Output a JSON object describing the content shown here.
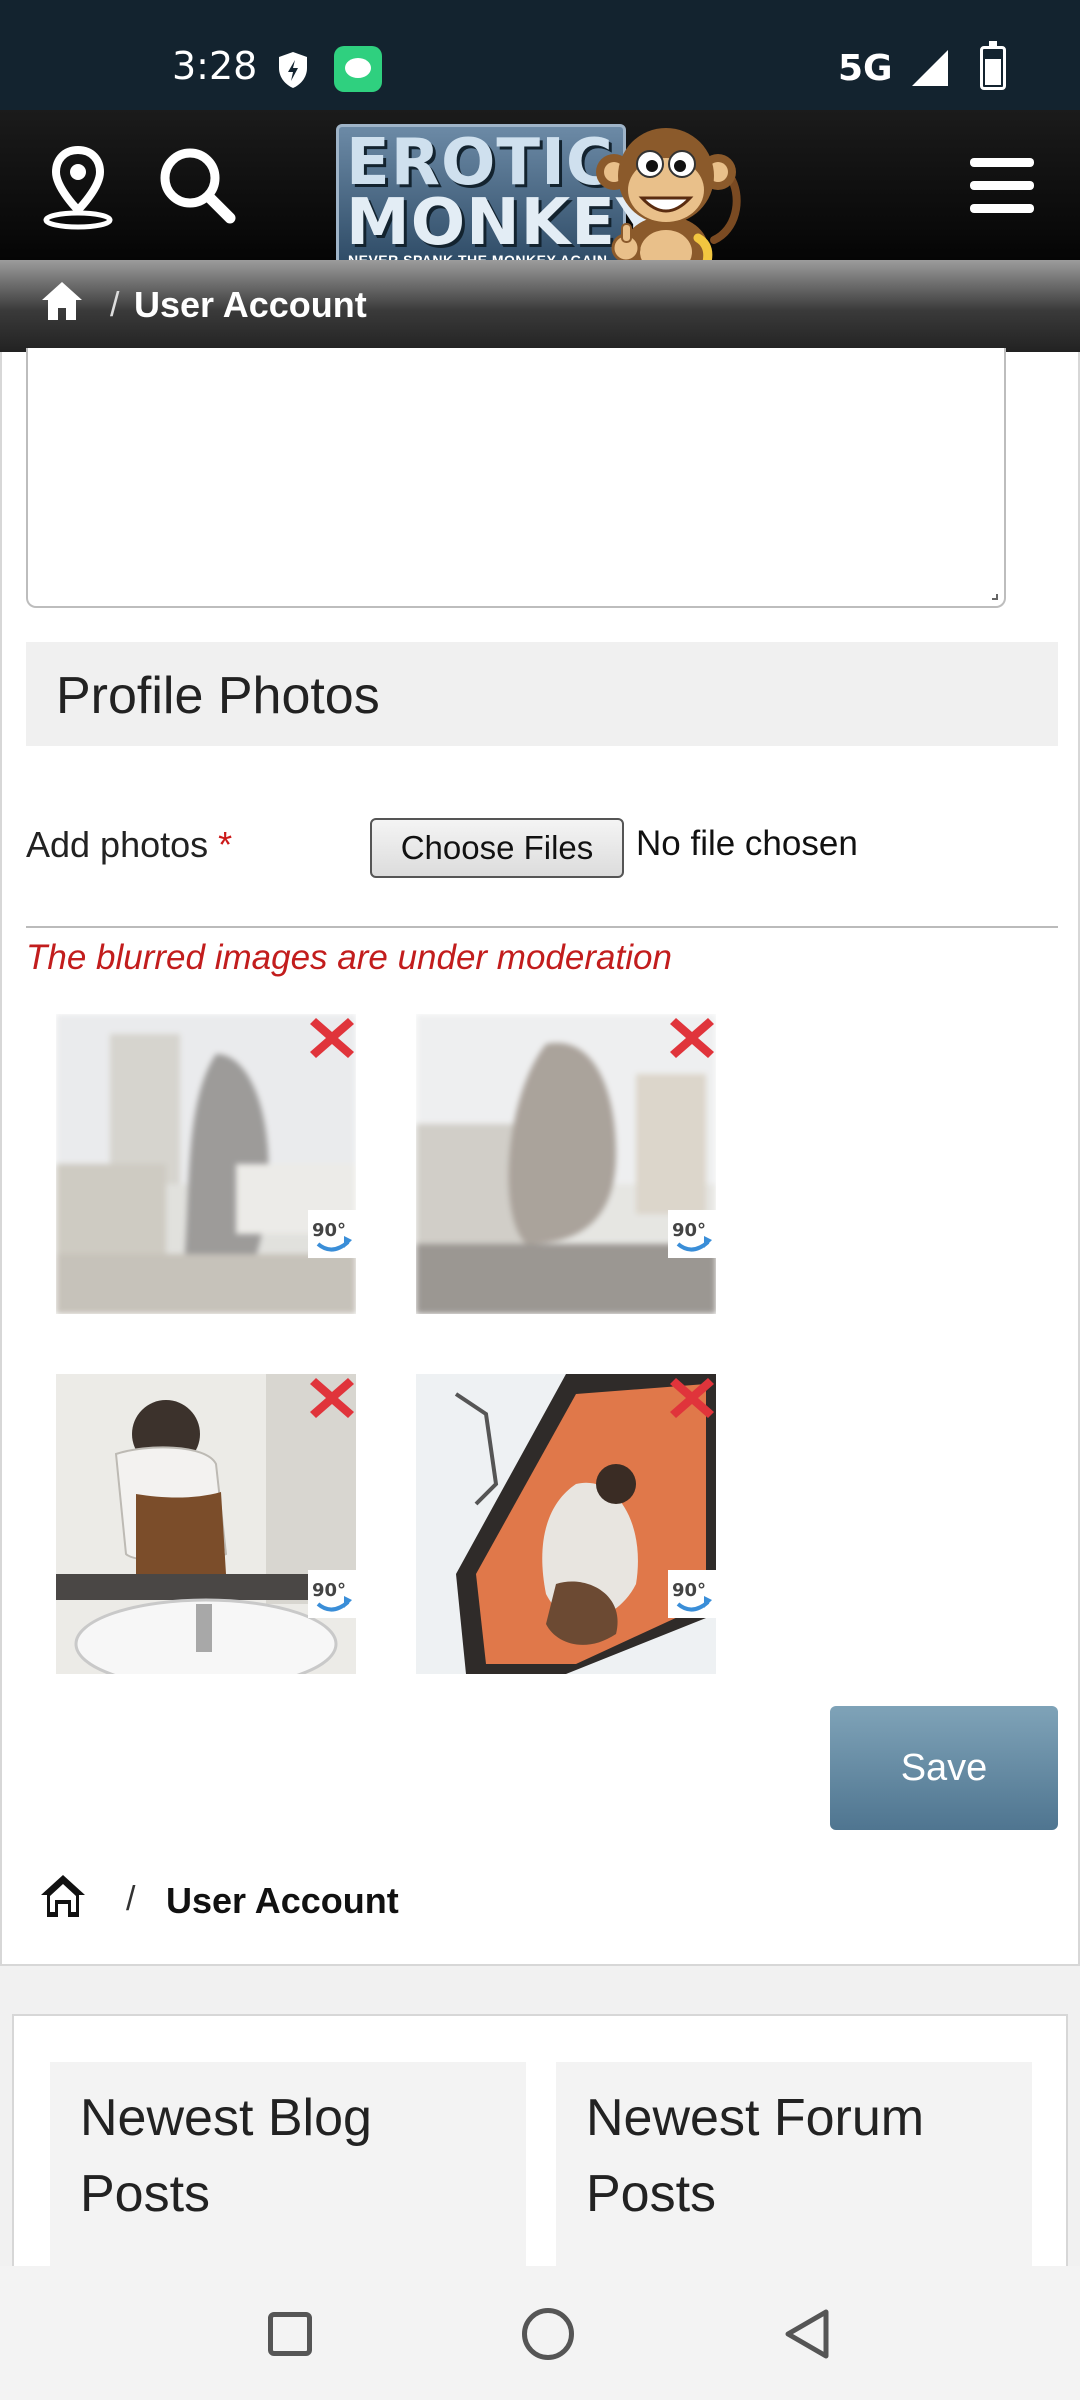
{
  "status_bar": {
    "time": "3:28",
    "network": "5G"
  },
  "header": {
    "logo": {
      "line1": "EROTIC",
      "line2": "MONKEY",
      "tagline": "NEVER SPANK THE MONKEY AGAIN"
    },
    "icons": [
      "location-pin-icon",
      "search-icon",
      "hamburger-menu-icon"
    ]
  },
  "breadcrumb": {
    "separator": "/",
    "current": "User Account"
  },
  "profile_photos": {
    "heading": "Profile Photos",
    "add_label": "Add photos",
    "required_mark": "*",
    "file_button": "Choose Files",
    "file_status": "No file chosen",
    "moderation_note": "The blurred images are under moderation",
    "photos": [
      {
        "status": "blurred"
      },
      {
        "status": "blurred"
      },
      {
        "status": "visible"
      },
      {
        "status": "visible"
      }
    ],
    "save_label": "Save"
  },
  "footer_breadcrumb": {
    "separator": "/",
    "current": "User Account"
  },
  "widgets": {
    "blog_title": "Newest Blog Posts",
    "forum_title": "Newest Forum Posts"
  },
  "colors": {
    "header_bg": "#13232f",
    "required": "#cc1a1a",
    "save_button": "#5f849c"
  }
}
